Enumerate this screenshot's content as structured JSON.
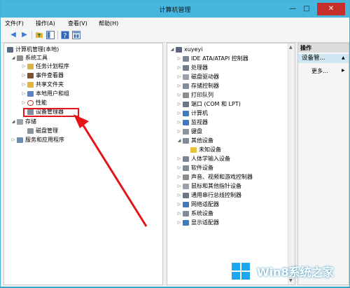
{
  "window": {
    "title": "计算机管理",
    "minimize": "—",
    "maximize": "□",
    "close": "✕"
  },
  "menu": [
    "文件(F)",
    "操作(A)",
    "查看(V)",
    "帮助(H)"
  ],
  "toolbar": {
    "icons": [
      "back-arrow-icon",
      "forward-arrow-icon",
      "up-folder-icon",
      "show-hide-tree-icon",
      "help-icon",
      "properties-icon"
    ],
    "colors": {
      "arrow": "#3d7ad6",
      "folder": "#e4b53c",
      "panel": "#4e77b0"
    }
  },
  "tree": {
    "root": "计算机管理(本地)",
    "system_tools": "系统工具",
    "task_scheduler": "任务计划程序",
    "event_viewer": "事件查看器",
    "shared_folders": "共享文件夹",
    "local_users": "本地用户和组",
    "performance": "性能",
    "device_manager": "设备管理器",
    "storage": "存储",
    "disk_management": "磁盘管理",
    "services_apps": "服务和应用程序"
  },
  "devices": {
    "computer_name": "xuyeyi",
    "items": [
      "IDE ATA/ATAPI 控制器",
      "处理器",
      "磁盘驱动器",
      "存储控制器",
      "打印队列",
      "端口 (COM 和 LPT)",
      "计算机",
      "监视器",
      "键盘",
      "其他设备",
      "未知设备",
      "人体学输入设备",
      "软件设备",
      "声音、视频和游戏控制器",
      "鼠标和其他指针设备",
      "通用串行总线控制器",
      "网络适配器",
      "系统设备",
      "显示适配器"
    ]
  },
  "actions": {
    "header": "操作",
    "section": "设备管...",
    "more": "更多..."
  },
  "annotation": {
    "color": "#e4151a"
  },
  "watermark": {
    "text": "Win8系统之家",
    "color": "#1da7ee"
  }
}
